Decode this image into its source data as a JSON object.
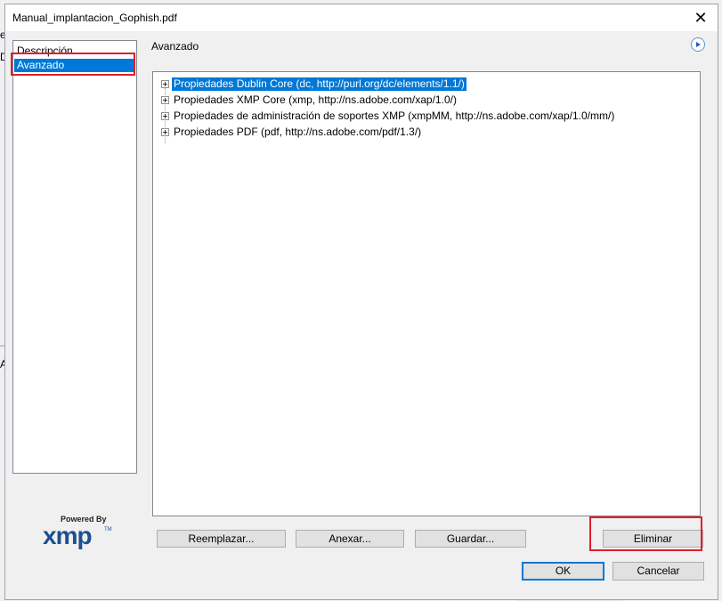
{
  "dialog": {
    "title": "Manual_implantacion_Gophish.pdf",
    "close_label": "✕"
  },
  "background": {
    "frag1": "e",
    "frag2": "D",
    "frag3": "A"
  },
  "sidebar": {
    "items": [
      {
        "label": "Descripción",
        "selected": false
      },
      {
        "label": "Avanzado",
        "selected": true
      }
    ]
  },
  "panel": {
    "title": "Avanzado"
  },
  "tree": {
    "items": [
      {
        "label": "Propiedades Dublin Core (dc, http://purl.org/dc/elements/1.1/)",
        "selected": true
      },
      {
        "label": "Propiedades XMP Core (xmp, http://ns.adobe.com/xap/1.0/)",
        "selected": false
      },
      {
        "label": "Propiedades de administración de soportes XMP (xmpMM, http://ns.adobe.com/xap/1.0/mm/)",
        "selected": false
      },
      {
        "label": "Propiedades PDF (pdf, http://ns.adobe.com/pdf/1.3/)",
        "selected": false
      }
    ]
  },
  "buttons": {
    "replace": "Reemplazar...",
    "append": "Anexar...",
    "save": "Guardar...",
    "delete": "Eliminar",
    "ok": "OK",
    "cancel": "Cancelar"
  },
  "logo": {
    "powered_by": "Powered By",
    "xmp": "xmp",
    "tm": "TM"
  },
  "colors": {
    "selection": "#0078d7",
    "highlight_box": "#e01f2a",
    "logo": "#1c4f8f"
  }
}
